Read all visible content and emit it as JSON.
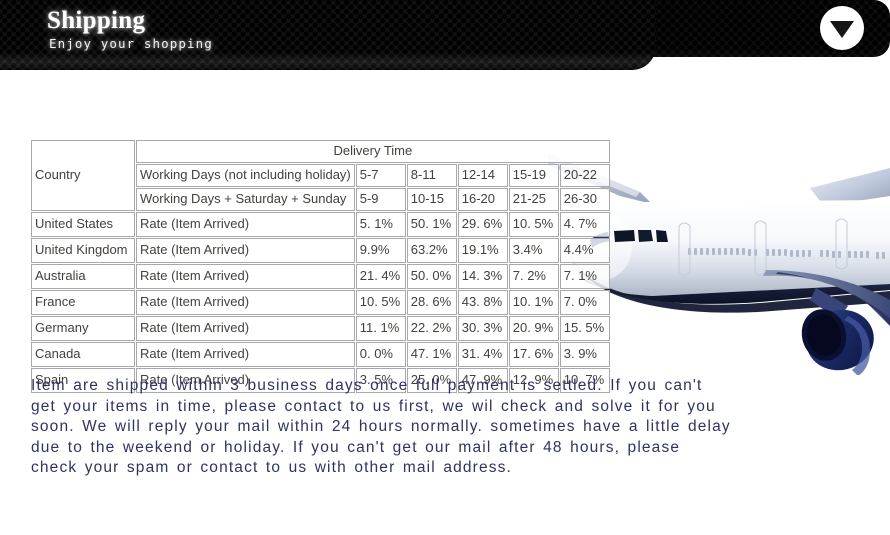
{
  "banner": {
    "title": "Shipping",
    "subtitle": "Enjoy your shopping",
    "collapse_icon": "triangle-down-icon",
    "background_color": "#0d0d0d",
    "text_color": "#ffffff"
  },
  "artwork": {
    "name": "airliner-photo",
    "description": "Commercial passenger jet airliner",
    "body_color": "#f2f4f8",
    "engine_color": "#16255e",
    "belly_color": "#1c2340"
  },
  "table": {
    "delivery_time_header": "Delivery Time",
    "country_header": "Country",
    "row_headers": {
      "working_days": "Working Days (not including holiday)",
      "working_days_weekend": "Working Days + Saturday + Sunday",
      "rate": "Rate (Item Arrived)"
    },
    "working_days": [
      "5-7",
      "8-11",
      "12-14",
      "15-19",
      "20-22"
    ],
    "working_days_weekend": [
      "5-9",
      "10-15",
      "16-20",
      "21-25",
      "26-30"
    ],
    "rows": [
      {
        "country": "United States",
        "label": "Rate (Item Arrived)",
        "rates": [
          "5. 1%",
          "50. 1%",
          "29. 6%",
          "10. 5%",
          "4. 7%"
        ]
      },
      {
        "country": "United Kingdom",
        "label": "Rate (Item Arrived)",
        "rates": [
          "9.9%",
          "63.2%",
          "19.1%",
          "3.4%",
          "4.4%"
        ]
      },
      {
        "country": "Australia",
        "label": "Rate (Item Arrived)",
        "rates": [
          "21. 4%",
          "50. 0%",
          "14. 3%",
          "7. 2%",
          "7. 1%"
        ]
      },
      {
        "country": "France",
        "label": "Rate (Item Arrived)",
        "rates": [
          "10. 5%",
          "28. 6%",
          "43. 8%",
          "10. 1%",
          "7. 0%"
        ]
      },
      {
        "country": "Germany",
        "label": "Rate (Item Arrived)",
        "rates": [
          "11. 1%",
          "22. 2%",
          "30. 3%",
          "20. 9%",
          "15. 5%"
        ]
      },
      {
        "country": "Canada",
        "label": "Rate (Item Arrived)",
        "rates": [
          "0. 0%",
          "47. 1%",
          "31. 4%",
          "17. 6%",
          "3. 9%"
        ]
      },
      {
        "country": "Spain",
        "label": "Rate (Item Arrived)",
        "rates": [
          "3. 5%",
          "25. 0%",
          "47. 9%",
          "12. 9%",
          "10. 7%"
        ]
      }
    ]
  },
  "note": {
    "text": "Item are shipped within 3 business days once full payment is settled. If you can't get your items in time, please contact to us first, we wil check and solve it for you soon. We will reply your mail within 24 hours normally. sometimes have a little delay due to the weekend or holiday. If you can't get our mail after 48 hours, please check your spam or contact to us with other mail address.",
    "color": "#2f3361"
  }
}
